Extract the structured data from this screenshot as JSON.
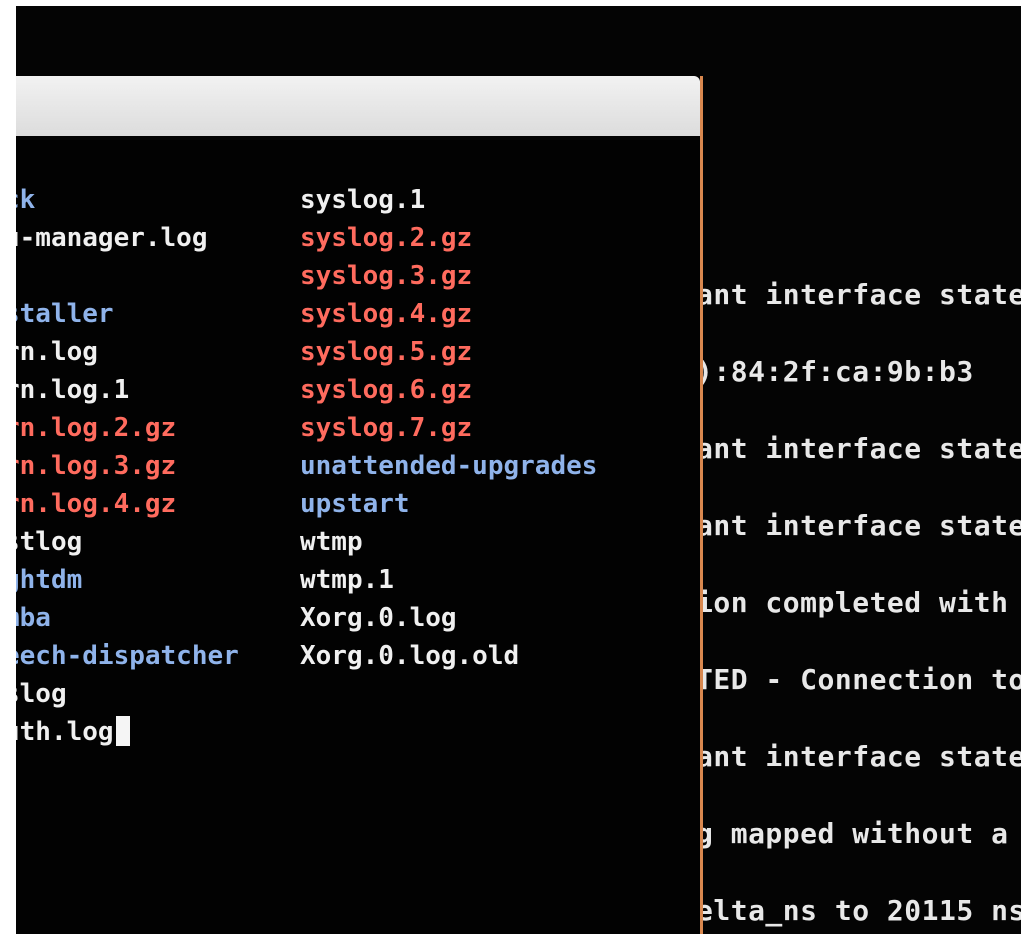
{
  "background_terminal": {
    "lines": [
      "ant interface state",
      "):84:2f:ca:9b:b3",
      "ant interface state",
      "ant interface state",
      "ion completed with",
      "TED - Connection to",
      "ant interface state",
      "g mapped without a",
      "elta_ns to 20115 ns"
    ]
  },
  "front_terminal": {
    "left_column": [
      {
        "text": "ck",
        "color": "blue"
      },
      {
        "text": "u-manager.log",
        "color": "white"
      },
      {
        "text": "",
        "color": "white"
      },
      {
        "text": "staller",
        "color": "blue"
      },
      {
        "text": "rn.log",
        "color": "white"
      },
      {
        "text": "rn.log.1",
        "color": "white"
      },
      {
        "text": "rn.log.2.gz",
        "color": "red"
      },
      {
        "text": "rn.log.3.gz",
        "color": "red"
      },
      {
        "text": "rn.log.4.gz",
        "color": "red"
      },
      {
        "text": "stlog",
        "color": "white"
      },
      {
        "text": "ghtdm",
        "color": "blue"
      },
      {
        "text": "mba",
        "color": "blue"
      },
      {
        "text": "eech-dispatcher",
        "color": "blue"
      },
      {
        "text": "slog",
        "color": "white"
      },
      {
        "text": "uth.log",
        "color": "white"
      }
    ],
    "right_column": [
      {
        "text": "syslog.1",
        "color": "white"
      },
      {
        "text": "syslog.2.gz",
        "color": "red"
      },
      {
        "text": "syslog.3.gz",
        "color": "red"
      },
      {
        "text": "syslog.4.gz",
        "color": "red"
      },
      {
        "text": "syslog.5.gz",
        "color": "red"
      },
      {
        "text": "syslog.6.gz",
        "color": "red"
      },
      {
        "text": "syslog.7.gz",
        "color": "red"
      },
      {
        "text": "unattended-upgrades",
        "color": "blue"
      },
      {
        "text": "upstart",
        "color": "blue"
      },
      {
        "text": "wtmp",
        "color": "white"
      },
      {
        "text": "wtmp.1",
        "color": "white"
      },
      {
        "text": "Xorg.0.log",
        "color": "white"
      },
      {
        "text": "Xorg.0.log.old",
        "color": "white"
      }
    ]
  },
  "colors": {
    "white": "#f0f0f0",
    "blue": "#8fb3ea",
    "red": "#ff6b5e",
    "window_border": "#d9884f"
  }
}
